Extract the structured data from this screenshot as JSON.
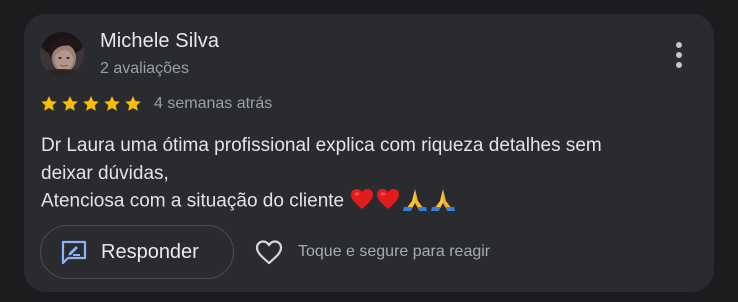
{
  "review": {
    "author_name": "Michele Silva",
    "review_count": "2 avaliações",
    "rating": 5,
    "max_rating": 5,
    "date": "4 semanas atrás",
    "text_lines": [
      "Dr Laura uma ótima profissional explica com riqueza detalhes sem",
      "deixar dúvidas,",
      "Atenciosa com a situação do cliente"
    ],
    "emojis": [
      "red-heart",
      "red-heart",
      "folded-hands",
      "folded-hands"
    ]
  },
  "actions": {
    "reply_label": "Responder",
    "react_label": "Toque e segure para reagir"
  },
  "icons": {
    "more": "more-vertical-icon",
    "reply": "reply-icon",
    "react": "heart-outline-icon",
    "star": "star-icon"
  },
  "colors": {
    "background": "#1b1c1e",
    "card": "#2a2b2f",
    "star": "#fbbc04",
    "reply_icon": "#8ab4f8",
    "primary_text": "#e8e8ea",
    "secondary_text": "#9aa0a6"
  }
}
